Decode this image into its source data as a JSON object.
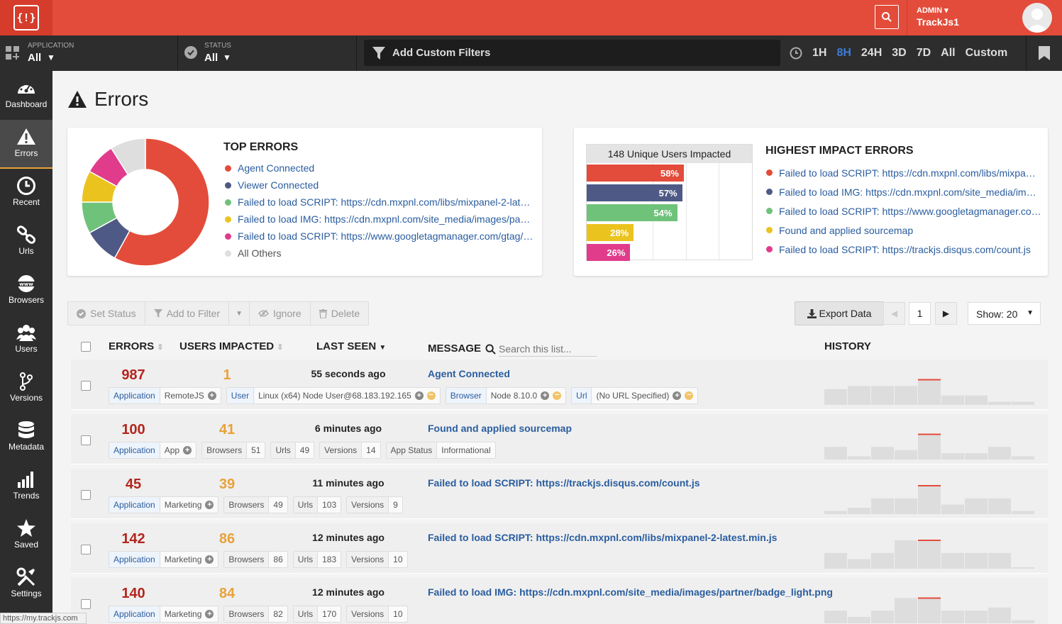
{
  "topbar": {
    "logo_text": "{!}",
    "admin_label": "ADMIN",
    "admin_name": "TrackJs1"
  },
  "filters": {
    "application_label": "APPLICATION",
    "application_value": "All",
    "status_label": "STATUS",
    "status_value": "All",
    "custom_placeholder": "Add Custom Filters",
    "times": [
      "1H",
      "8H",
      "24H",
      "3D",
      "7D",
      "All",
      "Custom"
    ],
    "active_time": "8H"
  },
  "sidebar": {
    "items": [
      {
        "label": "Dashboard",
        "icon": "gauge-icon"
      },
      {
        "label": "Errors",
        "icon": "warning-icon"
      },
      {
        "label": "Recent",
        "icon": "clock-icon"
      },
      {
        "label": "Urls",
        "icon": "link-icon"
      },
      {
        "label": "Browsers",
        "icon": "www-icon"
      },
      {
        "label": "Users",
        "icon": "users-icon"
      },
      {
        "label": "Versions",
        "icon": "branch-icon"
      },
      {
        "label": "Metadata",
        "icon": "database-icon"
      },
      {
        "label": "Trends",
        "icon": "bar-chart-icon"
      },
      {
        "label": "Saved",
        "icon": "star-icon"
      },
      {
        "label": "Settings",
        "icon": "tools-icon"
      }
    ],
    "active": "Errors"
  },
  "page": {
    "title": "Errors"
  },
  "top_errors": {
    "title": "TOP ERRORS",
    "items": [
      {
        "label": "Agent Connected",
        "color": "#e34c3a"
      },
      {
        "label": "Viewer Connected",
        "color": "#4e5a85"
      },
      {
        "label": "Failed to load SCRIPT: https://cdn.mxpnl.com/libs/mixpanel-2-lat…",
        "color": "#6fc27a"
      },
      {
        "label": "Failed to load IMG: https://cdn.mxpnl.com/site_media/images/pa…",
        "color": "#ebc31f"
      },
      {
        "label": "Failed to load SCRIPT: https://www.googletagmanager.com/gtag/…",
        "color": "#e13c8b"
      },
      {
        "label": "All Others",
        "color": "#dedede"
      }
    ]
  },
  "chart_data": {
    "type": "pie",
    "categories": [
      "Agent Connected",
      "Viewer Connected",
      "Failed to load SCRIPT: https://cdn.mxpnl.com/libs/mixpanel-2-lat…",
      "Failed to load IMG: https://cdn.mxpnl.com/site_media/images/pa…",
      "Failed to load SCRIPT: https://www.googletagmanager.com/gtag/…",
      "All Others"
    ],
    "values": [
      58,
      9,
      8,
      8,
      8,
      9
    ]
  },
  "impact": {
    "box_title": "148 Unique Users Impacted",
    "title": "HIGHEST IMPACT ERRORS",
    "bars": [
      {
        "pct": "58%",
        "value": 58,
        "color": "#e34c3a"
      },
      {
        "pct": "57%",
        "value": 57,
        "color": "#4e5a85"
      },
      {
        "pct": "54%",
        "value": 54,
        "color": "#6fc27a"
      },
      {
        "pct": "28%",
        "value": 28,
        "color": "#ebc31f"
      },
      {
        "pct": "26%",
        "value": 26,
        "color": "#e13c8b"
      }
    ],
    "items": [
      {
        "label": "Failed to load SCRIPT: https://cdn.mxpnl.com/libs/mixpa…",
        "color": "#e34c3a"
      },
      {
        "label": "Failed to load IMG: https://cdn.mxpnl.com/site_media/im…",
        "color": "#4e5a85"
      },
      {
        "label": "Failed to load SCRIPT: https://www.googletagmanager.co…",
        "color": "#6fc27a"
      },
      {
        "label": "Found and applied sourcemap",
        "color": "#ebc31f"
      },
      {
        "label": "Failed to load SCRIPT: https://trackjs.disqus.com/count.js",
        "color": "#e13c8b"
      }
    ]
  },
  "toolbar": {
    "set_status": "Set Status",
    "add_filter": "Add to Filter",
    "ignore": "Ignore",
    "delete": "Delete",
    "export": "Export Data",
    "page": "1",
    "show": "Show: 20"
  },
  "table": {
    "headers": {
      "errors": "ERRORS",
      "users": "USERS IMPACTED",
      "last_seen": "LAST SEEN",
      "message": "MESSAGE",
      "history": "HISTORY"
    },
    "search_placeholder": "Search this list...",
    "rows": [
      {
        "errors": "987",
        "users": "1",
        "last_seen": "55 seconds ago",
        "message": "Agent Connected",
        "tags": [
          {
            "k": "Application",
            "v": "RemoteJS",
            "plus": true,
            "minus": false,
            "blue": true
          },
          {
            "k": "User",
            "v": "Linux (x64) Node User@68.183.192.165",
            "plus": true,
            "minus": true,
            "blue": true
          },
          {
            "k": "Browser",
            "v": "Node 8.10.0",
            "plus": true,
            "minus": true,
            "blue": true
          },
          {
            "k": "Url",
            "v": "(No URL Specified)",
            "plus": true,
            "minus": true,
            "blue": true
          }
        ],
        "history": [
          5,
          6,
          6,
          6,
          8,
          3,
          3,
          1,
          1
        ]
      },
      {
        "errors": "100",
        "users": "41",
        "last_seen": "6 minutes ago",
        "message": "Found and applied sourcemap",
        "tags": [
          {
            "k": "Application",
            "v": "App",
            "plus": true,
            "minus": false,
            "blue": true
          },
          {
            "k": "Browsers",
            "v": "51",
            "plus": false,
            "minus": false,
            "blue": false
          },
          {
            "k": "Urls",
            "v": "49",
            "plus": false,
            "minus": false,
            "blue": false
          },
          {
            "k": "Versions",
            "v": "14",
            "plus": false,
            "minus": false,
            "blue": false
          },
          {
            "k": "App Status",
            "v": "Informational",
            "plus": false,
            "minus": false,
            "blue": false
          }
        ],
        "history": [
          4,
          1,
          4,
          3,
          8,
          2,
          2,
          4,
          1
        ]
      },
      {
        "errors": "45",
        "users": "39",
        "last_seen": "11 minutes ago",
        "message": "Failed to load SCRIPT: https://trackjs.disqus.com/count.js",
        "tags": [
          {
            "k": "Application",
            "v": "Marketing",
            "plus": true,
            "minus": false,
            "blue": true
          },
          {
            "k": "Browsers",
            "v": "49",
            "plus": false,
            "minus": false,
            "blue": false
          },
          {
            "k": "Urls",
            "v": "103",
            "plus": false,
            "minus": false,
            "blue": false
          },
          {
            "k": "Versions",
            "v": "9",
            "plus": false,
            "minus": false,
            "blue": false
          }
        ],
        "history": [
          1,
          2,
          5,
          5,
          9,
          3,
          5,
          5,
          1
        ]
      },
      {
        "errors": "142",
        "users": "86",
        "last_seen": "12 minutes ago",
        "message": "Failed to load SCRIPT: https://cdn.mxpnl.com/libs/mixpanel-2-latest.min.js",
        "tags": [
          {
            "k": "Application",
            "v": "Marketing",
            "plus": true,
            "minus": false,
            "blue": true
          },
          {
            "k": "Browsers",
            "v": "86",
            "plus": false,
            "minus": false,
            "blue": false
          },
          {
            "k": "Urls",
            "v": "183",
            "plus": false,
            "minus": false,
            "blue": false
          },
          {
            "k": "Versions",
            "v": "10",
            "plus": false,
            "minus": false,
            "blue": false
          }
        ],
        "history": [
          5,
          3,
          5,
          9,
          9,
          5,
          5,
          5,
          0
        ]
      },
      {
        "errors": "140",
        "users": "84",
        "last_seen": "12 minutes ago",
        "message": "Failed to load IMG: https://cdn.mxpnl.com/site_media/images/partner/badge_light.png",
        "tags": [
          {
            "k": "Application",
            "v": "Marketing",
            "plus": true,
            "minus": false,
            "blue": true
          },
          {
            "k": "Browsers",
            "v": "82",
            "plus": false,
            "minus": false,
            "blue": false
          },
          {
            "k": "Urls",
            "v": "170",
            "plus": false,
            "minus": false,
            "blue": false
          },
          {
            "k": "Versions",
            "v": "10",
            "plus": false,
            "minus": false,
            "blue": false
          }
        ],
        "history": [
          4,
          2,
          4,
          8,
          8,
          4,
          4,
          5,
          1
        ]
      }
    ]
  },
  "status_url": "https://my.trackjs.com",
  "colors": {
    "brand": "#e34c3a",
    "link": "#2a5d9f",
    "errors": "#b3261e",
    "users": "#e8a23a",
    "active_time": "#3b7dd8"
  }
}
